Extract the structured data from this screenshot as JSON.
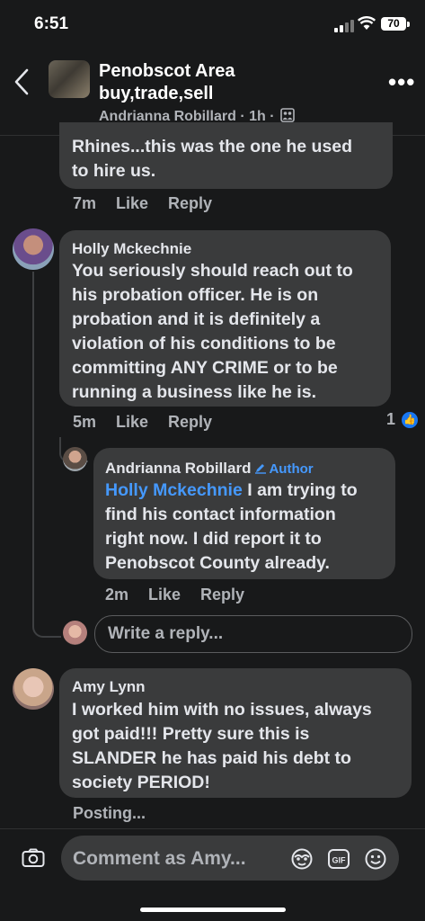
{
  "status_bar": {
    "time": "6:51",
    "battery": "70"
  },
  "header": {
    "group_title_line1": "Penobscot Area",
    "group_title_line2": "buy,trade,sell",
    "subtitle": "Andrianna Robillard · 1h ·"
  },
  "comments": [
    {
      "text_lines": [
        "Rhines...this was the one he used",
        "to hire us."
      ],
      "time": "7m",
      "like_label": "Like",
      "reply_label": "Reply"
    },
    {
      "author": "Holly Mckechnie",
      "text_lines": [
        "You seriously should reach out to",
        "his probation officer. He is on",
        "probation and it is definitely a",
        "violation of his conditions to be",
        "committing ANY CRIME or to be",
        "running a business like he is."
      ],
      "time": "5m",
      "like_label": "Like",
      "reply_label": "Reply",
      "reaction_count": "1"
    },
    {
      "author": "Andrianna Robillard",
      "badge": "Author",
      "mention": "Holly Mckechnie",
      "text_lines": [
        " I am trying to",
        "find his contact information",
        "right now. I did report it to",
        "Penobscot County already."
      ],
      "time": "2m",
      "like_label": "Like",
      "reply_label": "Reply"
    },
    {
      "author": "Amy Lynn",
      "text_lines": [
        "I worked him with no issues, always",
        "got paid!!! Pretty sure this is",
        "SLANDER he has paid his debt to",
        "society PERIOD!"
      ],
      "status": "Posting..."
    }
  ],
  "reply_box": {
    "placeholder": "Write a reply..."
  },
  "composer": {
    "placeholder": "Comment as Amy..."
  },
  "icons": [
    "back-chevron-icon",
    "more-icon",
    "camera-icon",
    "sticker-icon",
    "gif-icon",
    "emoji-icon",
    "like-icon",
    "pencil-icon"
  ],
  "colors": {
    "background": "#18191a",
    "bubble": "#3a3b3c",
    "accent": "#4599ff",
    "like_badge": "#1877f2"
  }
}
